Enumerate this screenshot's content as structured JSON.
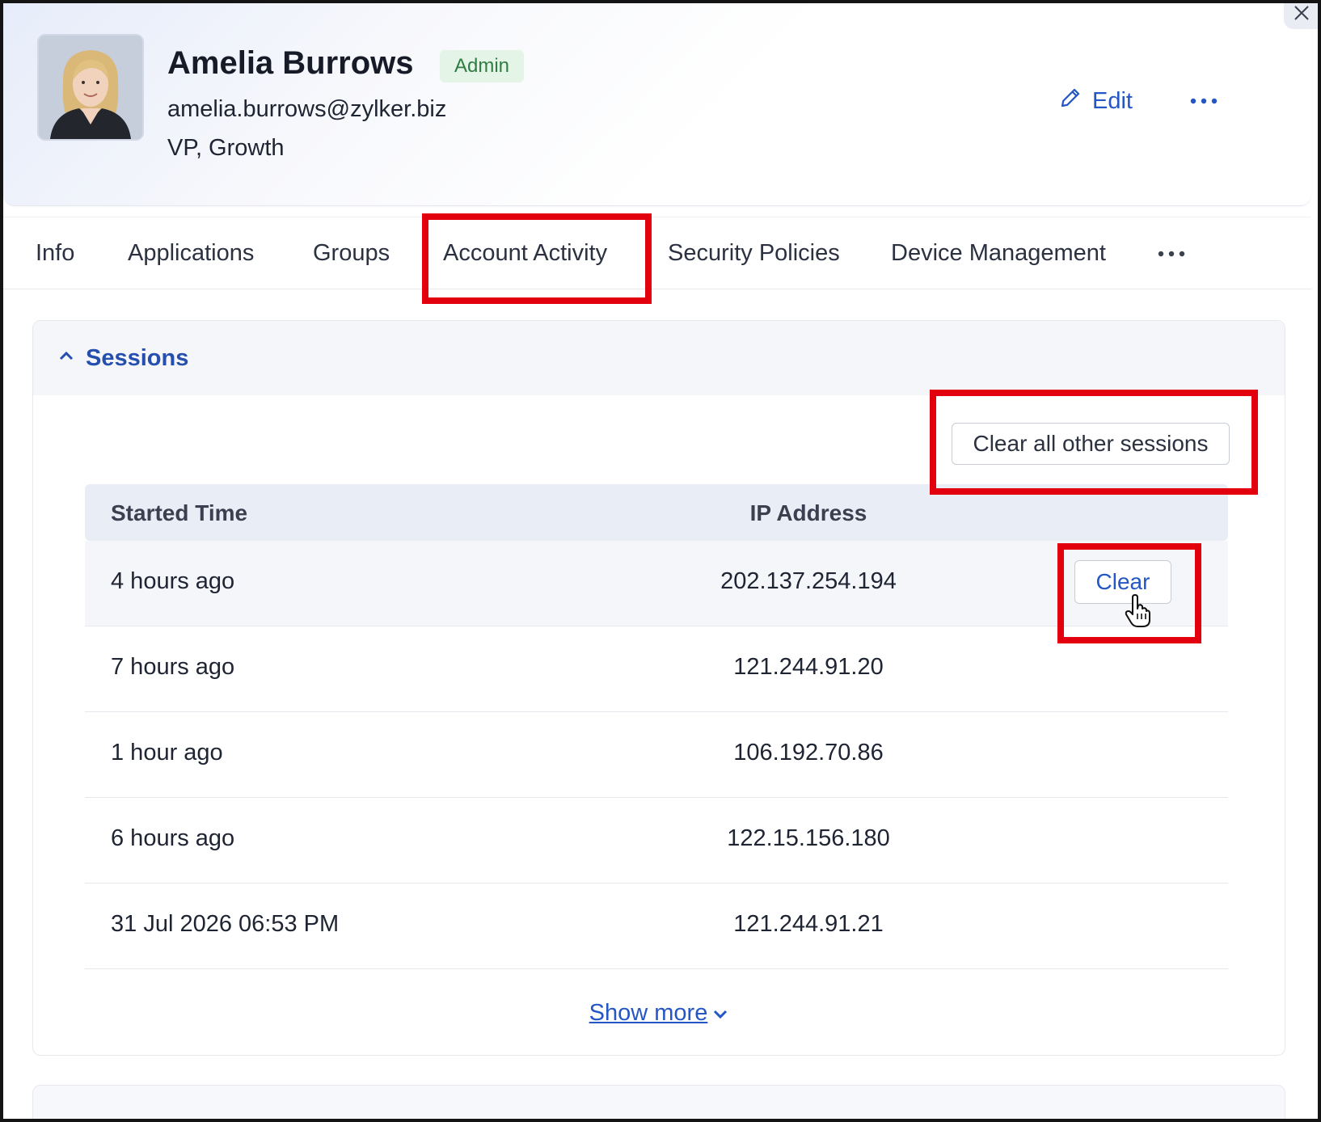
{
  "user": {
    "name": "Amelia Burrows",
    "role_badge": "Admin",
    "email": "amelia.burrows@zylker.biz",
    "title": "VP, Growth"
  },
  "header_actions": {
    "edit_label": "Edit"
  },
  "tabs": [
    {
      "label": "Info"
    },
    {
      "label": "Applications"
    },
    {
      "label": "Groups"
    },
    {
      "label": "Account Activity",
      "active": true
    },
    {
      "label": "Security Policies"
    },
    {
      "label": "Device Management"
    }
  ],
  "sessions": {
    "title": "Sessions",
    "expanded": true,
    "clear_all_label": "Clear all other sessions",
    "columns": {
      "started_time": "Started Time",
      "ip_address": "IP Address"
    },
    "rows": [
      {
        "started": "4 hours ago",
        "ip": "202.137.254.194",
        "action": "Clear"
      },
      {
        "started": "7 hours ago",
        "ip": "121.244.91.20"
      },
      {
        "started": "1 hour ago",
        "ip": "106.192.70.86"
      },
      {
        "started": "6 hours ago",
        "ip": "122.15.156.180"
      },
      {
        "started": "31 Jul 2026 06:53 PM",
        "ip": "121.244.91.21"
      }
    ],
    "show_more_label": "Show more"
  },
  "colors": {
    "accent": "#2456c6",
    "badge_text": "#2f7d43",
    "badge_bg": "#e4f4e6",
    "highlight": "#e2000e"
  },
  "icons": [
    "pencil-icon",
    "more-horizontal-icon",
    "close-icon",
    "chevron-up-icon",
    "chevron-down-icon",
    "hand-pointer-cursor-icon"
  ]
}
